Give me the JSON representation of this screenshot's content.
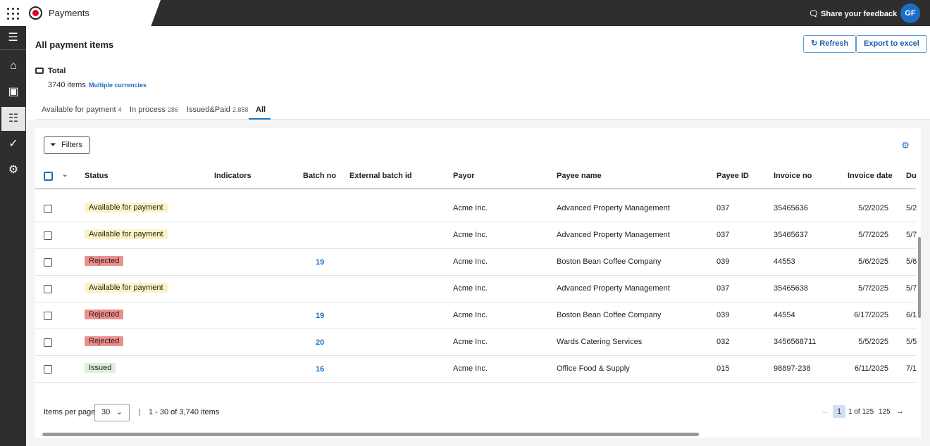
{
  "app": {
    "title": "Payments",
    "feedback": "Share your feedback",
    "avatar": "GF"
  },
  "sidebar": {
    "items": [
      "menu-icon",
      "home-icon",
      "money-icon",
      "list-icon",
      "check-circle-icon",
      "gear-icon"
    ],
    "active": "list-icon"
  },
  "page": {
    "title": "All payment items",
    "refresh": "Refresh",
    "export": "Export to excel"
  },
  "total": {
    "label": "Total",
    "items": "3740 items",
    "currencies": "Multiple currencies"
  },
  "tabs": [
    {
      "label": "Available for payment",
      "count": "4"
    },
    {
      "label": "In process",
      "count": "286"
    },
    {
      "label": "Issued&Paid",
      "count": "2,858"
    },
    {
      "label": "All",
      "count": ""
    }
  ],
  "table": {
    "filters": "Filters",
    "columns": [
      "Status",
      "Indicators",
      "Batch no",
      "External batch id",
      "Payor",
      "Payee name",
      "Payee ID",
      "Invoice no",
      "Invoice date",
      "Du"
    ],
    "rows": [
      {
        "status": "Available for payment",
        "type": "avail",
        "batch": "",
        "payor": "Acme Inc.",
        "payee": "Advanced Property Management",
        "payee_id": "037",
        "invoice": "35465636",
        "date": "5/2/2025",
        "due": "5/2"
      },
      {
        "status": "Available for payment",
        "type": "avail",
        "batch": "",
        "payor": "Acme Inc.",
        "payee": "Advanced Property Management",
        "payee_id": "037",
        "invoice": "35465637",
        "date": "5/7/2025",
        "due": "5/7"
      },
      {
        "status": "Rejected",
        "type": "rej",
        "batch": "19",
        "payor": "Acme Inc.",
        "payee": "Boston Bean Coffee Company",
        "payee_id": "039",
        "invoice": "44553",
        "date": "5/6/2025",
        "due": "5/6"
      },
      {
        "status": "Available for payment",
        "type": "avail",
        "batch": "",
        "payor": "Acme Inc.",
        "payee": "Advanced Property Management",
        "payee_id": "037",
        "invoice": "35465638",
        "date": "5/7/2025",
        "due": "5/7"
      },
      {
        "status": "Rejected",
        "type": "rej",
        "batch": "19",
        "payor": "Acme Inc.",
        "payee": "Boston Bean Coffee Company",
        "payee_id": "039",
        "invoice": "44554",
        "date": "6/17/2025",
        "due": "6/1"
      },
      {
        "status": "Rejected",
        "type": "rej",
        "batch": "20",
        "payor": "Acme Inc.",
        "payee": "Wards Catering Services",
        "payee_id": "032",
        "invoice": "3456568711",
        "date": "5/5/2025",
        "due": "5/5"
      },
      {
        "status": "Issued",
        "type": "iss",
        "batch": "16",
        "payor": "Acme Inc.",
        "payee": "Office Food & Supply",
        "payee_id": "015",
        "invoice": "98897-238",
        "date": "6/11/2025",
        "due": "7/1"
      }
    ]
  },
  "pager": {
    "items_per_page_label": "Items per page",
    "per_page": "30",
    "range": "1 - 30 of 3,740 items",
    "current": "1",
    "of": "1 of 125",
    "last": "125"
  }
}
